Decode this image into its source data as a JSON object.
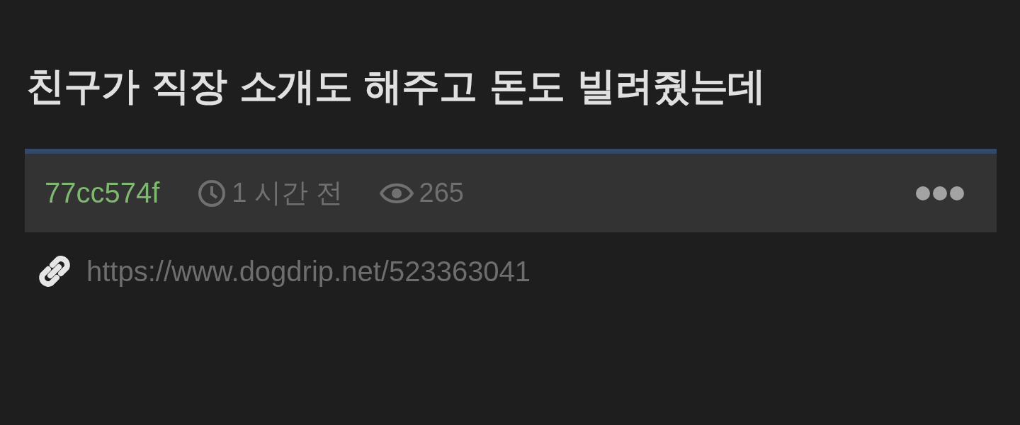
{
  "post": {
    "title": "친구가 직장 소개도 해주고 돈도 빌려줬는데",
    "author": "77cc574f",
    "time": "1 시간 전",
    "views": "265",
    "link": "https://www.dogdrip.net/523363041"
  }
}
